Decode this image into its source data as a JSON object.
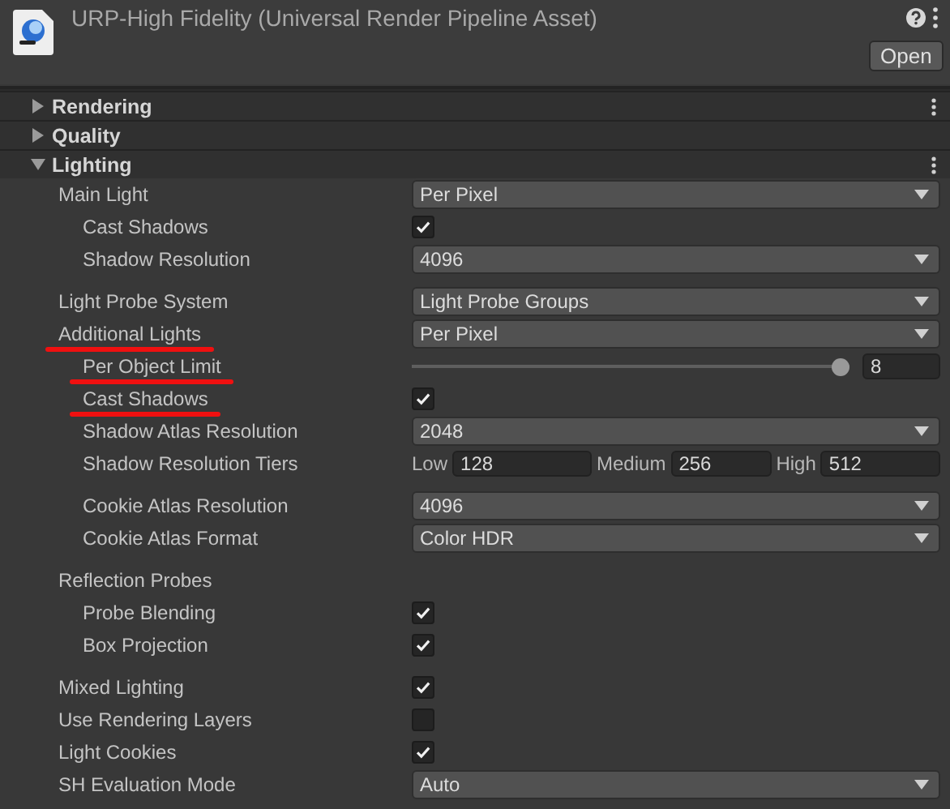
{
  "header": {
    "title": "URP-High Fidelity (Universal Render Pipeline Asset)",
    "open_button": "Open"
  },
  "sections": [
    {
      "title": "Rendering",
      "expanded": false,
      "menu": true
    },
    {
      "title": "Quality",
      "expanded": false,
      "menu": false
    },
    {
      "title": "Lighting",
      "expanded": true,
      "menu": true,
      "properties": [
        {
          "label": "Main Light",
          "kind": "dropdown",
          "value": "Per Pixel",
          "annotated": false,
          "children": [
            {
              "label": "Cast Shadows",
              "kind": "checkbox",
              "checked": true,
              "annotated": false
            },
            {
              "label": "Shadow Resolution",
              "kind": "dropdown",
              "value": "4096",
              "annotated": false
            }
          ]
        },
        {
          "label": "Light Probe System",
          "kind": "dropdown",
          "value": "Light Probe Groups",
          "annotated": false
        },
        {
          "label": "Additional Lights",
          "kind": "dropdown",
          "value": "Per Pixel",
          "annotated": true,
          "children": [
            {
              "label": "Per Object Limit",
              "kind": "slider",
              "level": 1,
              "value": "8",
              "annotated": true
            },
            {
              "label": "Cast Shadows",
              "kind": "checkbox",
              "checked": true,
              "annotated": true
            },
            {
              "label": "Shadow Atlas Resolution",
              "kind": "dropdown",
              "value": "2048",
              "annotated": false
            },
            {
              "label": "Shadow Resolution Tiers",
              "kind": "tiers",
              "annotated": false,
              "tiers": [
                {
                  "label": "Low",
                  "value": "128"
                },
                {
                  "label": "Medium",
                  "value": "256"
                },
                {
                  "label": "High",
                  "value": "512"
                }
              ]
            },
            {
              "label": "Cookie Atlas Resolution",
              "kind": "dropdown",
              "value": "4096",
              "annotated": false
            },
            {
              "label": "Cookie Atlas Format",
              "kind": "dropdown",
              "value": "Color HDR",
              "annotated": false
            }
          ]
        },
        {
          "label": "Reflection Probes",
          "kind": "label",
          "annotated": false,
          "children": [
            {
              "label": "Probe Blending",
              "kind": "checkbox",
              "checked": true,
              "annotated": false
            },
            {
              "label": "Box Projection",
              "kind": "checkbox",
              "checked": true,
              "annotated": false
            }
          ]
        },
        {
          "label": "Mixed Lighting",
          "kind": "checkbox",
          "checked": true,
          "annotated": false
        },
        {
          "label": "Use Rendering Layers",
          "kind": "checkbox",
          "checked": false,
          "annotated": false
        },
        {
          "label": "Light Cookies",
          "kind": "checkbox",
          "checked": true,
          "annotated": false
        },
        {
          "label": "SH Evaluation Mode",
          "kind": "dropdown",
          "value": "Auto",
          "annotated": false
        }
      ]
    }
  ]
}
